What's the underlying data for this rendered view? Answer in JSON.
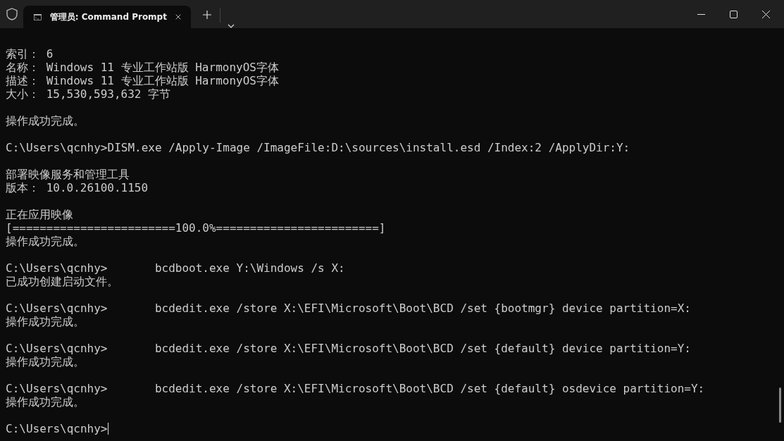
{
  "window": {
    "tab": {
      "title": "管理员: Command Prompt",
      "selected": true
    }
  },
  "console": {
    "blocks": [
      [
        "索引： 6",
        "名称： Windows 11 专业工作站版 HarmonyOS字体",
        "描述： Windows 11 专业工作站版 HarmonyOS字体",
        "大小： 15,530,593,632 字节"
      ],
      [
        "操作成功完成。"
      ],
      [
        "C:\\Users\\qcnhy>DISM.exe /Apply-Image /ImageFile:D:\\sources\\install.esd /Index:2 /ApplyDir:Y:"
      ],
      [
        "部署映像服务和管理工具",
        "版本： 10.0.26100.1150"
      ],
      [
        "正在应用映像",
        "[========================100.0%========================]",
        "操作成功完成。"
      ],
      [
        "C:\\Users\\qcnhy>       bcdboot.exe Y:\\Windows /s X:",
        "已成功创建启动文件。"
      ],
      [
        "C:\\Users\\qcnhy>       bcdedit.exe /store X:\\EFI\\Microsoft\\Boot\\BCD /set {bootmgr} device partition=X:",
        "操作成功完成。"
      ],
      [
        "C:\\Users\\qcnhy>       bcdedit.exe /store X:\\EFI\\Microsoft\\Boot\\BCD /set {default} device partition=Y:",
        "操作成功完成。"
      ],
      [
        "C:\\Users\\qcnhy>       bcdedit.exe /store X:\\EFI\\Microsoft\\Boot\\BCD /set {default} osdevice partition=Y:",
        "操作成功完成。"
      ]
    ],
    "prompt": {
      "text": "C:\\Users\\qcnhy>",
      "cursor": true
    }
  }
}
